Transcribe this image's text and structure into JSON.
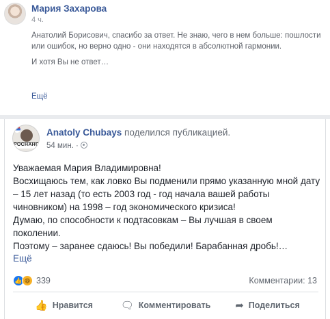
{
  "top_post": {
    "author": "Мария Захарова",
    "time": "4 ч.",
    "paragraphs": [
      "Анатолий Борисович, спасибо за ответ. Не знаю, чего в нем больше: пошлости или ошибок, но верно одно - они находятся в абсолютной гармонии.",
      "И хотя Вы не ответ…"
    ],
    "more_label": "Ещё"
  },
  "main_post": {
    "author": "Anatoly Chubays",
    "action": "поделился публикацией.",
    "time": "54 мин. ·",
    "avatar_text": "РОСНАНО",
    "lines": [
      "Уважаемая Мария Владимировна!",
      "Восхищаюсь тем, как ловко Вы подменили прямо указанную мной дату – 15 лет назад (то есть 2003 год - год начала вашей работы чиновником) на 1998 – год экономического кризиса!",
      "Думаю, по способности к подтасовкам – Вы лучшая в своем поколении.",
      "Поэтому – заранее сдаюсь! Вы победили! Барабанная дробь!…"
    ],
    "more_label": "Ещё",
    "reactions_count": "339",
    "comments_label": "Комментарии: 13"
  },
  "actions": {
    "like": "Нравится",
    "comment": "Комментировать",
    "share": "Поделиться"
  },
  "icons": {
    "like": "thumbs-up-icon",
    "comment": "comment-icon",
    "share": "share-icon",
    "audience": "globe-icon"
  },
  "colors": {
    "link": "#385898",
    "like_reaction": "#1877f2",
    "haha_reaction": "#f7b125"
  }
}
